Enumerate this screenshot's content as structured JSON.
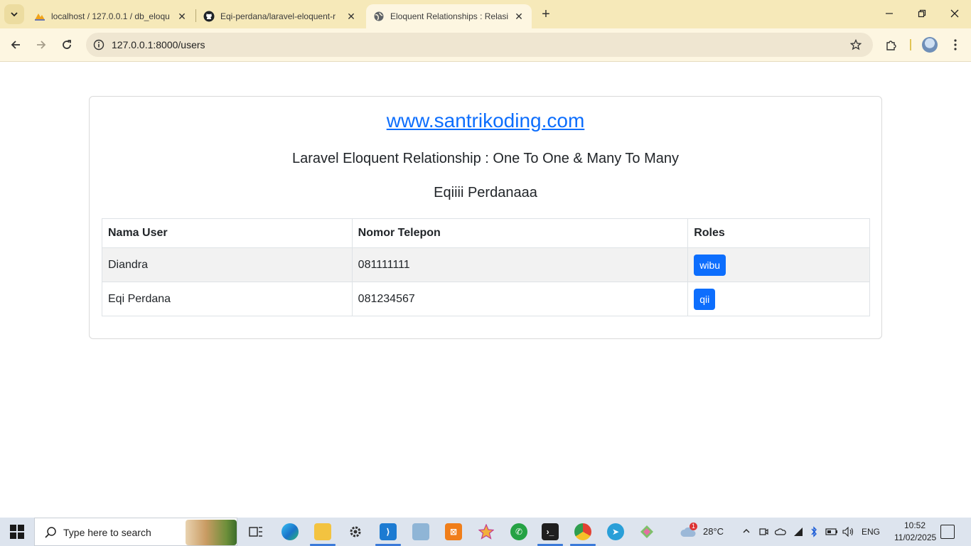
{
  "browser": {
    "tabs": [
      {
        "title": "localhost / 127.0.0.1 / db_eloqu",
        "favicon": "phpmyadmin-icon",
        "active": false
      },
      {
        "title": "Eqi-perdana/laravel-eloquent-r",
        "favicon": "github-icon",
        "active": false
      },
      {
        "title": "Eloquent Relationships : Relasi O",
        "favicon": "globe-icon",
        "active": true
      }
    ],
    "url": "127.0.0.1:8000/users"
  },
  "page": {
    "site_link": "www.santrikoding.com",
    "subtitle": "Laravel Eloquent Relationship : One To One & Many To Many",
    "author": "Eqiiii Perdanaaa",
    "table": {
      "headers": [
        "Nama User",
        "Nomor Telepon",
        "Roles"
      ],
      "rows": [
        {
          "name": "Diandra",
          "phone": "081111111",
          "role": "wibu"
        },
        {
          "name": "Eqi Perdana",
          "phone": "081234567",
          "role": "qii"
        }
      ]
    },
    "colors": {
      "primary": "#0d6efd",
      "tab_strip": "#f6e9b9"
    }
  },
  "taskbar": {
    "search_placeholder": "Type here to search",
    "weather": "28°C",
    "weather_badge": "1",
    "language": "ENG",
    "time": "10:52",
    "date": "11/02/2025"
  }
}
